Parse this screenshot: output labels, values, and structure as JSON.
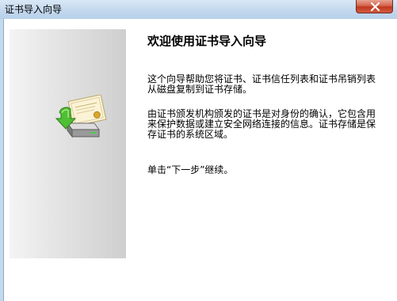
{
  "window": {
    "title": "证书导入向导"
  },
  "page": {
    "heading": "欢迎使用证书导入向导",
    "paragraphs": [
      "这个向导帮助您将证书、证书信任列表和证书吊销列表从磁盘复制到证书存储。",
      "由证书颁发机构颁发的证书是对身份的确认，它包含用来保护数据或建立安全网络连接的信息。证书存储是保存证书的系统区域。",
      "单击“下一步”继续。"
    ]
  },
  "icons": {
    "wizard": "certificate-import-icon",
    "close": "close-icon"
  },
  "colors": {
    "title_bar": "#c3d8ee",
    "close_button": "#c7432c"
  }
}
